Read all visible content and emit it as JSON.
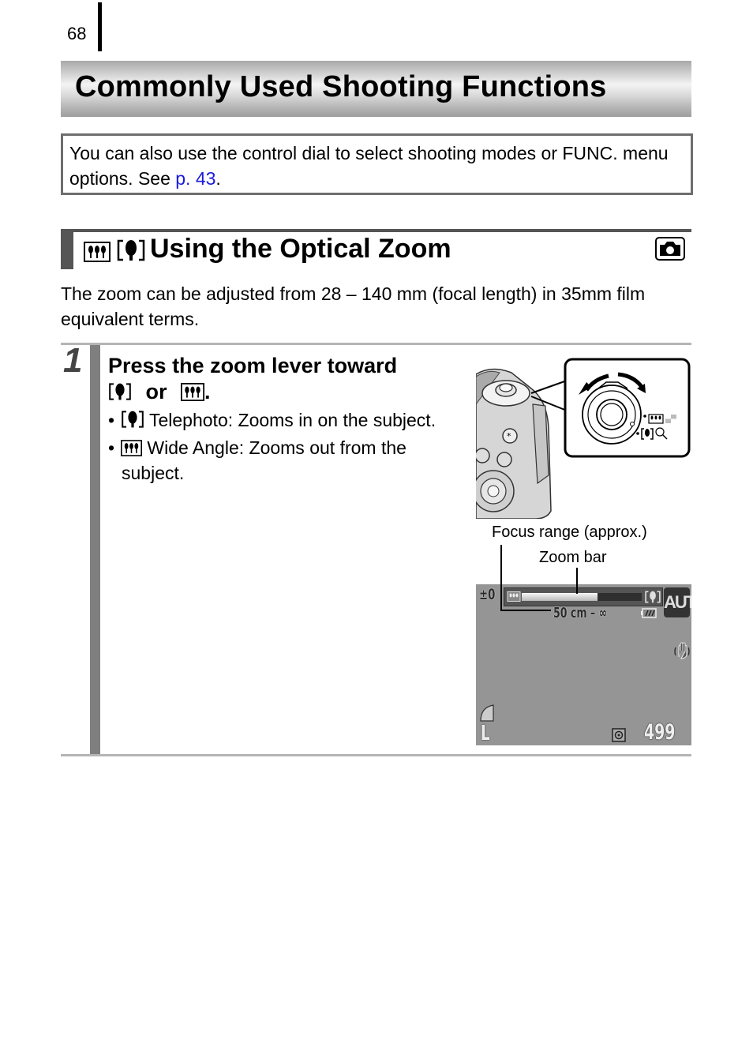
{
  "page": {
    "number": "68"
  },
  "chapter": {
    "title": "Commonly Used Shooting Functions"
  },
  "note": {
    "text_before_link": "You can also use the control dial to select shooting modes or FUNC. menu options. See ",
    "link_text": "p. 43",
    "text_after_link": "."
  },
  "section": {
    "icons": [
      "wide-angle-icon",
      "telephoto-icon"
    ],
    "title": "Using the Optical Zoom",
    "mode_badge_icon": "camera-icon",
    "intro": "The zoom can be adjusted from 28 – 140 mm (focal length) in 35mm film equivalent terms."
  },
  "step": {
    "number": "1",
    "heading_line1": "Press the zoom lever toward",
    "heading_or": "or",
    "heading_end": ".",
    "bullets": [
      {
        "bullet": "•",
        "icon": "telephoto-icon",
        "text": "Telephoto: Zooms in on the subject."
      },
      {
        "bullet": "•",
        "icon": "wide-angle-icon",
        "text": "Wide Angle: Zooms out from the",
        "text_cont": "subject."
      }
    ]
  },
  "illustration": {
    "description": "Camera zoom lever close-up",
    "lever_labels": [
      "wide-angle / index",
      "telephoto / magnify"
    ]
  },
  "callouts": {
    "focus_range": "Focus range (approx.)",
    "zoom_bar": "Zoom bar"
  },
  "lcd": {
    "exposure_comp": "±0",
    "zoom_position": 0.63,
    "mode": "AUTO",
    "focus_range_text": "50 cm – ∞",
    "shots_remaining": "499",
    "image_size": "L",
    "icons": [
      "wide-angle-icon",
      "telephoto-icon",
      "battery-icon",
      "image-stabilizer-icon",
      "compression-icon",
      "metering-icon"
    ]
  },
  "colors": {
    "link": "#1a1adc",
    "section_bar": "#555555",
    "step_bar": "#7f7f7f",
    "lcd_bg": "#959595"
  }
}
